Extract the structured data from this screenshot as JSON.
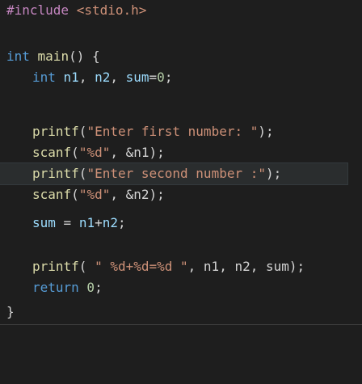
{
  "code": {
    "l1": {
      "directive": "#include",
      "path": " <stdio.h>"
    },
    "l2": {
      "type": "int",
      "name": " main",
      "rest": "() {"
    },
    "l3": {
      "type": "int",
      "v1": " n1",
      "c1": ",",
      "v2": " n2",
      "c2": ",",
      "v3": " sum",
      "eq": "=",
      "zero": "0",
      "semi": ";"
    },
    "l4": {
      "fn": "printf",
      "open": "(",
      "str": "\"Enter first number: \"",
      "close": ");"
    },
    "l5": {
      "fn": "scanf",
      "open": "(",
      "str": "\"%d\"",
      "rest": ", &n1);"
    },
    "l6": {
      "fn": "printf",
      "open": "(",
      "str": "\"Enter second number :\"",
      "close": ");"
    },
    "l7": {
      "fn": "scanf",
      "open": "(",
      "str": "\"%d\"",
      "rest": ", &n2);"
    },
    "l8": {
      "v": "sum",
      "eq": " = ",
      "a": "n1",
      "plus": "+",
      "b": "n2",
      "semi": ";"
    },
    "l9": {
      "fn": "printf",
      "open": "( ",
      "str": "\" %d+%d=%d \"",
      "rest": ", n1, n2, sum);"
    },
    "l10": {
      "kw": "return",
      "zero": " 0",
      "semi": ";"
    },
    "l11": {
      "brace": "}"
    }
  }
}
